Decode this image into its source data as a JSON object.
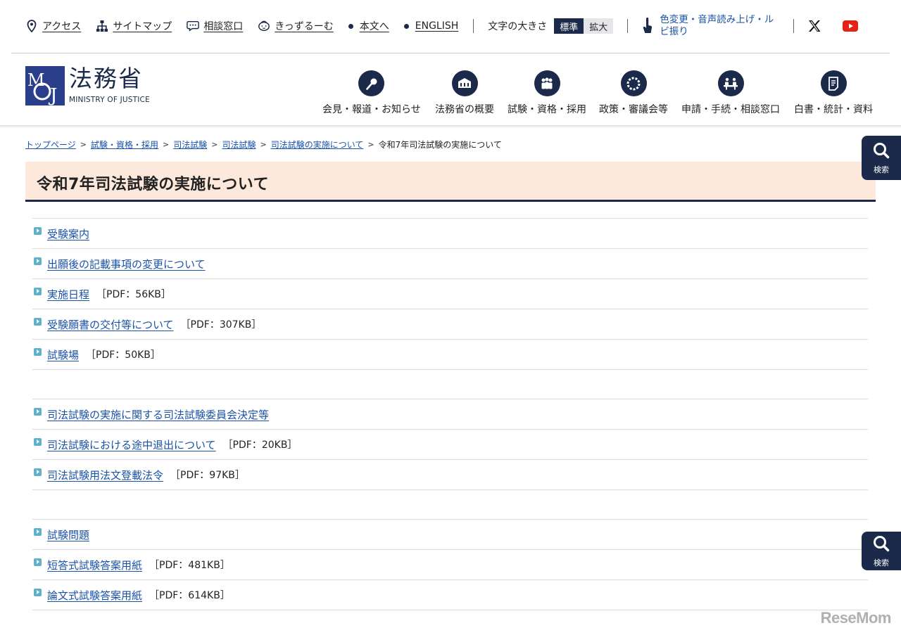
{
  "utility": {
    "access": "アクセス",
    "sitemap": "サイトマップ",
    "consult": "相談窓口",
    "kids": "きっずるーむ",
    "main_content": "本文へ",
    "english": "ENGLISH",
    "font_size_label": "文字の大きさ",
    "font_std": "標準",
    "font_large": "拡大",
    "color_tool": "色変更・音声読み上げ・ルビ振り"
  },
  "logo": {
    "ja": "法務省",
    "en": "MINISTRY OF JUSTICE",
    "mark": "MOJ"
  },
  "global_nav": [
    {
      "label": "会見・報道・お知らせ",
      "icon": "microphone-icon"
    },
    {
      "label": "法務省の概要",
      "icon": "building-icon"
    },
    {
      "label": "試験・資格・採用",
      "icon": "people-icon"
    },
    {
      "label": "政策・審議会等",
      "icon": "circle-dots-icon"
    },
    {
      "label": "申請・手続・相談窓口",
      "icon": "desk-icon"
    },
    {
      "label": "白書・統計・資料",
      "icon": "document-icon"
    }
  ],
  "breadcrumb": {
    "items": [
      "トップページ",
      "試験・資格・採用",
      "司法試験",
      "司法試験",
      "司法試験の実施について"
    ],
    "current": "令和7年司法試験の実施について"
  },
  "page": {
    "title": "令和7年司法試験の実施について"
  },
  "groups": [
    [
      {
        "label": "受験案内",
        "meta": ""
      },
      {
        "label": "出願後の記載事項の変更について",
        "meta": ""
      },
      {
        "label": "実施日程",
        "meta": "［PDF：56KB］"
      },
      {
        "label": "受験願書の交付等について",
        "meta": "［PDF：307KB］"
      },
      {
        "label": "試験場",
        "meta": "［PDF：50KB］"
      }
    ],
    [
      {
        "label": "司法試験の実施に関する司法試験委員会決定等",
        "meta": ""
      },
      {
        "label": "司法試験における途中退出について",
        "meta": "［PDF：20KB］"
      },
      {
        "label": "司法試験用法文登載法令",
        "meta": "［PDF：97KB］"
      }
    ],
    [
      {
        "label": "試験問題",
        "meta": ""
      },
      {
        "label": "短答式試験答案用紙",
        "meta": "［PDF：481KB］"
      },
      {
        "label": "論文式試験答案用紙",
        "meta": "［PDF：614KB］"
      }
    ]
  ],
  "search": {
    "label": "検索"
  },
  "watermark": "ReseMom",
  "colors": {
    "navy": "#1b2a4a",
    "link": "#1a52a8",
    "title_bg": "#fde8dc",
    "bullet": "#5fb1c9"
  }
}
